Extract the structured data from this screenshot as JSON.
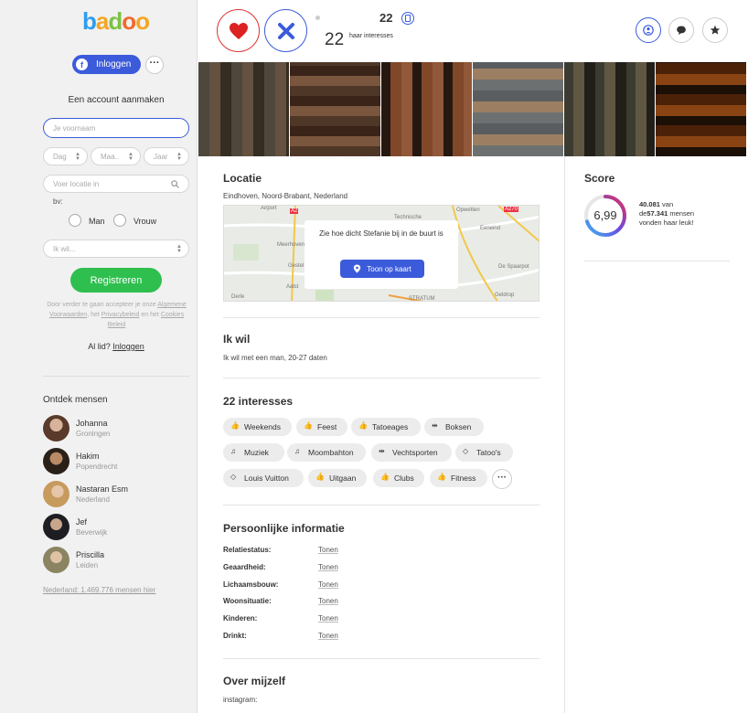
{
  "sidebar": {
    "logo": "badoo",
    "facebook_login": "Inloggen",
    "more": "···",
    "create_account_title": "Een account aanmaken",
    "firstname_placeholder": "Je voornaam",
    "day_placeholder": "Dag",
    "month_placeholder": "Maa..",
    "year_placeholder": "Jaar",
    "location_placeholder": "Voer locatie in",
    "gender_label": "bv:",
    "gender_man": "Man",
    "gender_woman": "Vrouw",
    "want_placeholder": "Ik wil...",
    "register_button": "Registreren",
    "terms_prefix": "Door verder te gaan accepteer je onze",
    "terms_link": "Algemene Voorwaarden",
    "terms_mid": ", het",
    "privacy_link": "Privacybeleid",
    "terms_mid2": "en het",
    "cookie_link": "Cookies Beleid",
    "already_member": "Al lid?",
    "login_link": "Inloggen",
    "discover_title": "Ontdek mensen",
    "people": [
      {
        "name": "Johanna",
        "city": "Groningen"
      },
      {
        "name": "Hakim",
        "city": "Popendrecht"
      },
      {
        "name": "Nastaran Esm",
        "city": "Nederland"
      },
      {
        "name": "Jef",
        "city": "Beverwijk"
      },
      {
        "name": "Priscilla",
        "city": "Leiden"
      }
    ],
    "country_count": "Nederland: 1.469.776 mensen hier"
  },
  "header": {
    "age": "22",
    "interests_count": "22",
    "interests_label": "haar interesses"
  },
  "location": {
    "title": "Locatie",
    "place": "Eindhoven, Noord-Brabant, Nederland",
    "map_question": "Zie hoe dicht Stefanie bij in de buurt is",
    "map_button": "Toon op kaart",
    "map_labels": [
      "Airport",
      "Technische",
      "Opwetten",
      "Meerhoven",
      "Gestel",
      "De Spaarpot",
      "Derle",
      "STRATUM",
      "Geldrop",
      "Aalst",
      "Eeneind",
      "A2",
      "A270"
    ]
  },
  "wants": {
    "title": "Ik wil",
    "text": "Ik wil met een man, 20-27 daten"
  },
  "interests": {
    "title": "22 interesses",
    "tags": [
      {
        "label": "Weekends",
        "icon": "thumb-icon"
      },
      {
        "label": "Feest",
        "icon": "thumb-icon"
      },
      {
        "label": "Tatoeages",
        "icon": "thumb-icon"
      },
      {
        "label": "Boksen",
        "icon": "dumbbell-icon"
      },
      {
        "label": "Muziek",
        "icon": "music-icon"
      },
      {
        "label": "Moombahton",
        "icon": "music-icon"
      },
      {
        "label": "Vechtsporten",
        "icon": "dumbbell-icon"
      },
      {
        "label": "Tatoo's",
        "icon": "diamond-icon"
      },
      {
        "label": "Louis Vuitton",
        "icon": "diamond-icon"
      },
      {
        "label": "Uitgaan",
        "icon": "thumb-icon"
      },
      {
        "label": "Clubs",
        "icon": "thumb-icon"
      },
      {
        "label": "Fitness",
        "icon": "thumb-icon"
      }
    ],
    "more": "···"
  },
  "personal": {
    "title": "Persoonlijke informatie",
    "rows": [
      {
        "key": "Relatiestatus:",
        "value": "Tonen"
      },
      {
        "key": "Geaardheid:",
        "value": "Tonen"
      },
      {
        "key": "Lichaamsbouw:",
        "value": "Tonen"
      },
      {
        "key": "Woonsituatie:",
        "value": "Tonen"
      },
      {
        "key": "Kinderen:",
        "value": "Tonen"
      },
      {
        "key": "Drinkt:",
        "value": "Tonen"
      }
    ]
  },
  "about": {
    "title": "Over mijzelf",
    "text": "instagram:"
  },
  "score": {
    "title": "Score",
    "value": "6,99",
    "fraction": 0.7,
    "liked": "40.081",
    "of_text": "van de",
    "total": "57.341",
    "suffix": "mensen vonden haar leuk!"
  },
  "colors": {
    "accent": "#3b5bdb",
    "like": "#dd3333",
    "register": "#2fbf4f"
  }
}
